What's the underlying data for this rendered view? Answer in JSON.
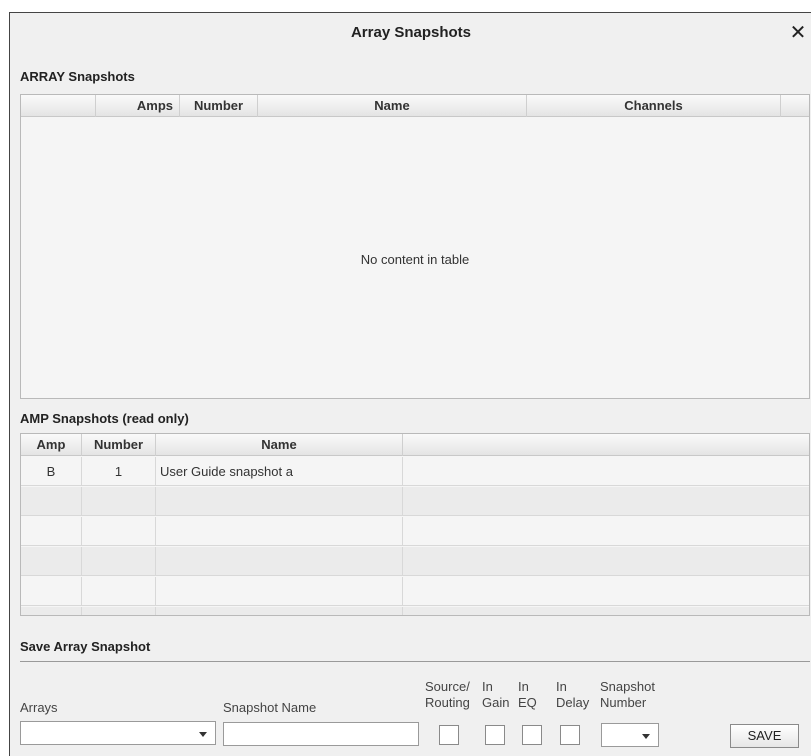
{
  "dialog": {
    "title": "Array Snapshots",
    "close_icon": "close-icon"
  },
  "array_section": {
    "label": "ARRAY Snapshots",
    "columns": [
      "",
      "Amps",
      "Number",
      "Name",
      "Channels",
      ""
    ],
    "empty_message": "No content in table"
  },
  "amp_section": {
    "label": "AMP Snapshots (read only)",
    "columns": [
      "Amp",
      "Number",
      "Name",
      ""
    ],
    "rows": [
      {
        "amp": "B",
        "number": "1",
        "name": "User Guide snapshot a"
      }
    ]
  },
  "save_section": {
    "label": "Save Array Snapshot",
    "arrays_label": "Arrays",
    "arrays_value": "",
    "snapshot_name_label": "Snapshot Name",
    "snapshot_name_value": "",
    "source_routing_label": "Source/ Routing",
    "in_gain_label": "In Gain",
    "in_eq_label": "In EQ",
    "in_delay_label": "In Delay",
    "snapshot_number_label": "Snapshot Number",
    "snapshot_number_value": "",
    "save_label": "SAVE"
  }
}
